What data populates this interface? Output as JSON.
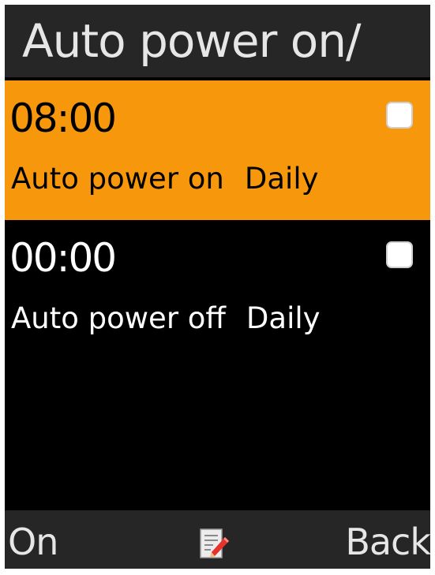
{
  "title": "Auto power on/",
  "items": [
    {
      "time": "08:00",
      "label": "Auto power on",
      "repeat": "Daily",
      "selected": true,
      "checked": false
    },
    {
      "time": "00:00",
      "label": "Auto power off",
      "repeat": "Daily",
      "selected": false,
      "checked": false
    }
  ],
  "softkeys": {
    "left": "On",
    "center_icon": "edit-icon",
    "right": "Back"
  },
  "colors": {
    "accent": "#f7970b",
    "bar": "#262626",
    "background": "#000000"
  }
}
